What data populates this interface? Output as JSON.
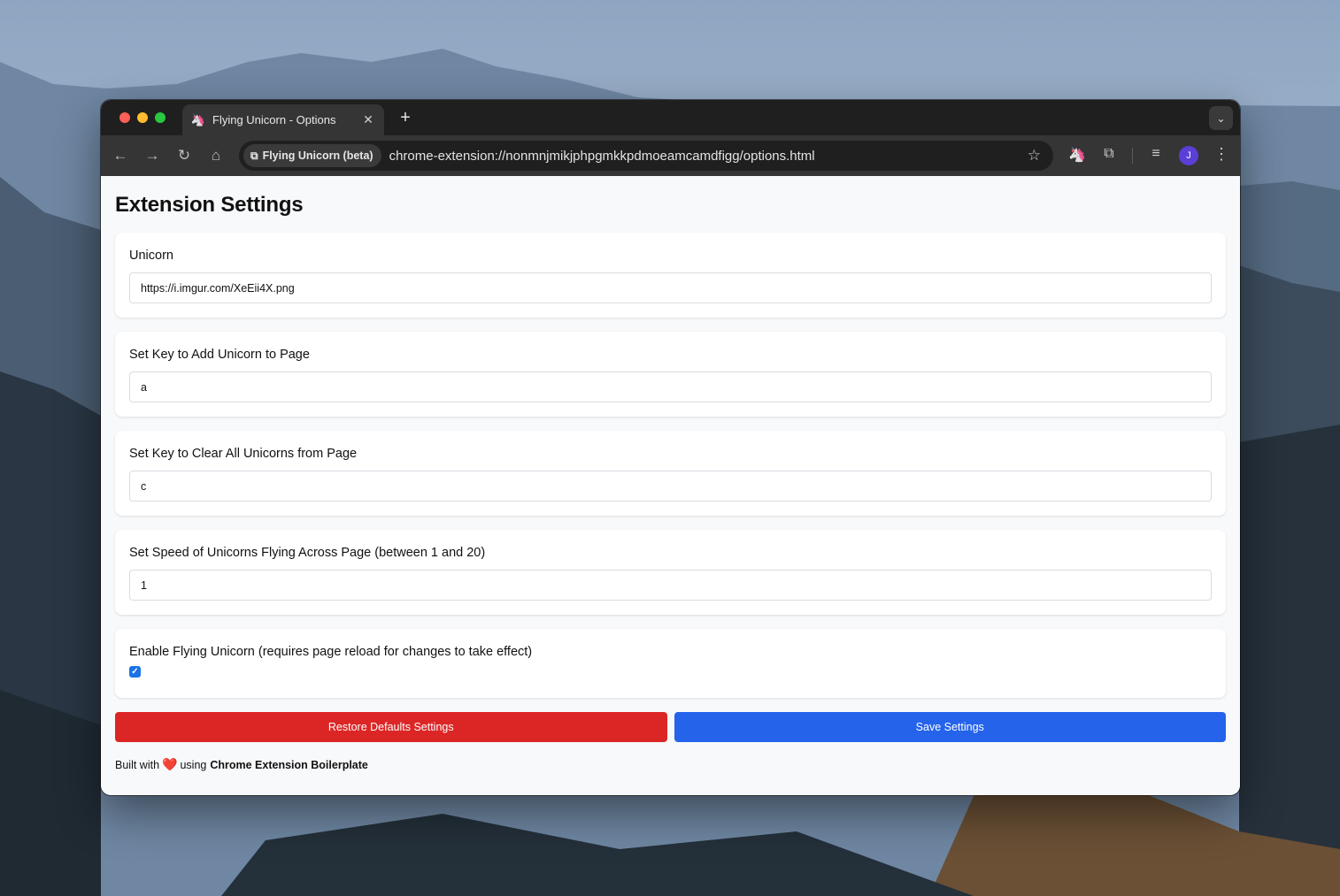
{
  "browser": {
    "tab_title": "Flying Unicorn - Options",
    "tab_favicon": "unicorn-icon",
    "new_tab_symbol": "+",
    "close_symbol": "✕",
    "chip_label": "Flying Unicorn (beta)",
    "url": "chrome-extension://nonmnjmikjphpgmkkpdmoeamcamdfigg/options.html",
    "avatar_letter": "J"
  },
  "page": {
    "title": "Extension Settings",
    "fields": [
      {
        "label": "Unicorn",
        "value": "https://i.imgur.com/XeEii4X.png"
      },
      {
        "label": "Set Key to Add Unicorn to Page",
        "value": "a"
      },
      {
        "label": "Set Key to Clear All Unicorns from Page",
        "value": "c"
      },
      {
        "label": "Set Speed of Unicorns Flying Across Page (between 1 and 20)",
        "value": "1"
      }
    ],
    "enable_label": "Enable Flying Unicorn (requires page reload for changes to take effect)",
    "enable_checked": true,
    "restore_button": "Restore Defaults Settings",
    "save_button": "Save Settings",
    "footer_prefix": "Built with",
    "footer_heart": "❤️",
    "footer_middle": "using",
    "footer_link": "Chrome Extension Boilerplate"
  },
  "colors": {
    "restore": "#dc2626",
    "save": "#2563eb",
    "checkbox": "#1a73e8",
    "avatar": "#5b3fd6"
  }
}
